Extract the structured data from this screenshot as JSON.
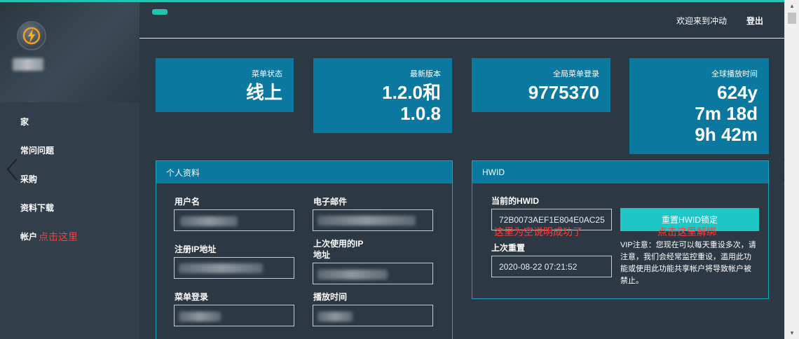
{
  "header": {
    "welcome": "欢迎来到冲动",
    "logout": "登出"
  },
  "sidebar": {
    "items": [
      {
        "label": "家"
      },
      {
        "label": "常问问题"
      },
      {
        "label": "采购"
      },
      {
        "label": "资料下载"
      },
      {
        "label": "帐户",
        "note": "点击这里"
      }
    ]
  },
  "stats": [
    {
      "label": "菜单状态",
      "value": "线上"
    },
    {
      "label": "最新版本",
      "value": "1.2.0和\n1.0.8"
    },
    {
      "label": "全局菜单登录",
      "value": "9775370"
    },
    {
      "label": "全球播放时间",
      "value": "624y\n7m 18d\n9h 42m"
    }
  ],
  "profile": {
    "title": "个人资料",
    "username_label": "用户名",
    "email_label": "电子邮件",
    "reg_ip_label": "注册IP地址",
    "last_ip_label": "上次使用的IP\n地址",
    "menu_login_label": "菜单登录",
    "playtime_label": "播放时间"
  },
  "hwid": {
    "title": "HWID",
    "current_label": "当前的HWID",
    "current_value": "72B0073AEF1E804E0AC25",
    "last_reset_label": "上次重置",
    "last_reset_value": "2020-08-22 07:21:52",
    "reset_button": "重置HWID锁定",
    "annotation_field": "这里为空说明成功了",
    "annotation_button": "点击这里解绑",
    "vip_note": "VIP注意：您现在可以每天重设多次，请注意，我们会经常监控重设，滥用此功能或使用此功能共享帐户将导致帐户被禁止。"
  },
  "colors": {
    "background": "#2c3944",
    "sidebar": "#323f4a",
    "card": "#0b78a0",
    "accent": "#20c4b0",
    "button": "#1fc6c6",
    "annotation": "#ff3b3b"
  }
}
